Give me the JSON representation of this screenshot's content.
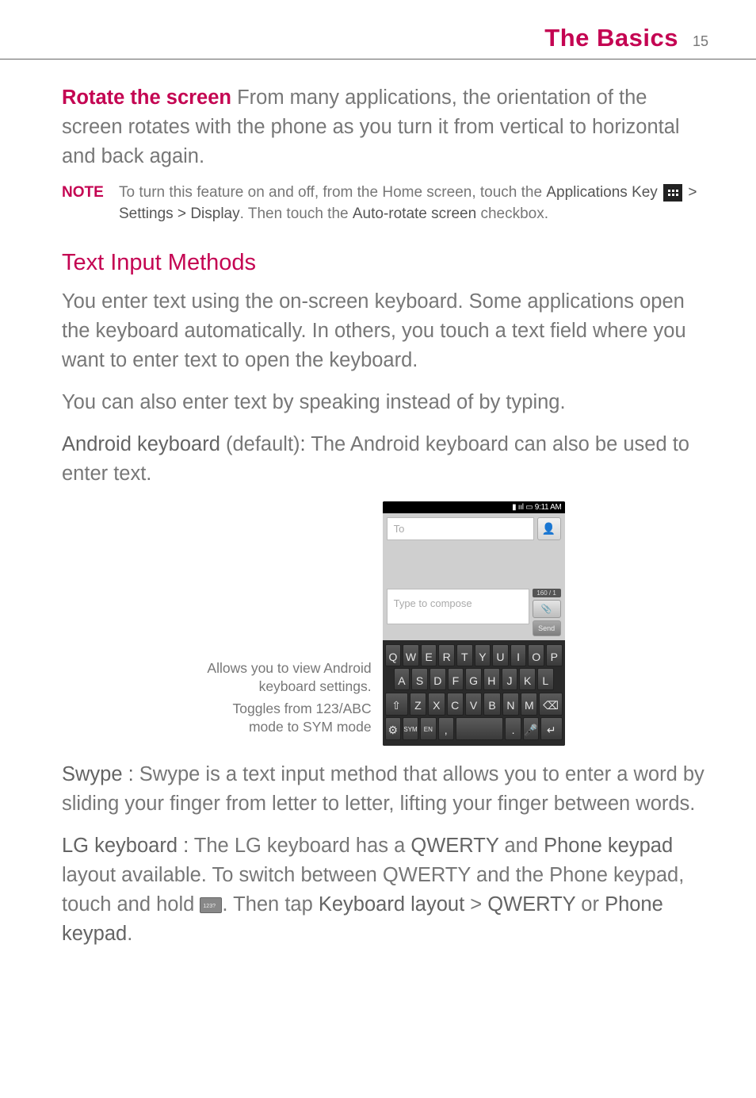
{
  "header": {
    "title": "The Basics",
    "page": "15"
  },
  "rotate": {
    "label": "Rotate the screen",
    "body": "  From many applications, the orientation of the screen rotates with the phone as you turn it from vertical to horizontal and back again."
  },
  "note": {
    "label": "NOTE",
    "part1": "To turn this feature on and off, from the Home screen, touch the ",
    "apps_key": "Applications Key",
    "part2": " > ",
    "settings": "Settings",
    "part3": " > ",
    "display": "Display",
    "part4": ". Then touch the ",
    "auto": "Auto-rotate screen",
    "part5": " checkbox.",
    "icon_name": "applications-key-icon"
  },
  "section": {
    "title": "Text Input Methods"
  },
  "para1": "You enter text using the on-screen keyboard. Some applications open the keyboard automatically. In others, you touch a text field where you want to enter text to open the keyboard.",
  "para2": "You can also enter text by speaking instead of by typing.",
  "android": {
    "label": "Android keyboard",
    "default": " (default)",
    "colon": ": ",
    "body": "The Android keyboard can also be used to enter text."
  },
  "figure": {
    "callout1_a": "Allows you to view Android",
    "callout1_b": "keyboard settings.",
    "callout2_a": "Toggles from 123/ABC",
    "callout2_b": "mode to SYM mode",
    "statusbar": "9:11 AM",
    "to_placeholder": "To",
    "compose_placeholder": "Type to compose",
    "counter": "160 / 1",
    "send": "Send",
    "row1": [
      "Q",
      "W",
      "E",
      "R",
      "T",
      "Y",
      "U",
      "I",
      "O",
      "P"
    ],
    "row2": [
      "A",
      "S",
      "D",
      "F",
      "G",
      "H",
      "J",
      "K",
      "L"
    ],
    "row3": [
      "Z",
      "X",
      "C",
      "V",
      "B",
      "N",
      "M"
    ],
    "row4": [
      "SYM",
      "EN",
      ",",
      ".",
      "↵"
    ]
  },
  "swype": {
    "label": "Swype : ",
    "body": "Swype is a text input method that allows you to enter a word by sliding your finger from letter to letter, lifting your finger between words."
  },
  "lg": {
    "label": "LG keyboard : ",
    "part1": "The LG keyboard has a ",
    "q": "QWERTY",
    "part2": " and ",
    "pk": "Phone keypad",
    "part3": " layout available. To switch between QWERTY and the Phone keypad, touch and hold ",
    "part4": ". Then tap ",
    "kl": "Keyboard layout",
    "part5": " > ",
    "q2": "QWERTY",
    "part6": " or ",
    "pk2": "Phone keypad",
    "part7": "."
  }
}
